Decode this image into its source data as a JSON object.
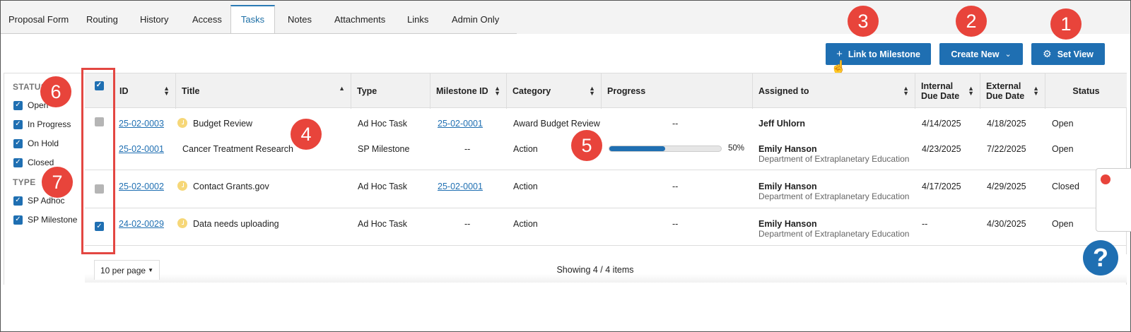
{
  "tabs": [
    {
      "label": "Proposal Form"
    },
    {
      "label": "Routing"
    },
    {
      "label": "History"
    },
    {
      "label": "Access"
    },
    {
      "label": "Tasks"
    },
    {
      "label": "Notes"
    },
    {
      "label": "Attachments"
    },
    {
      "label": "Links"
    },
    {
      "label": "Admin Only"
    }
  ],
  "active_tab": "Tasks",
  "toolbar": {
    "link_label": "Link to Milestone",
    "create_label": "Create New",
    "setview_label": "Set View"
  },
  "callouts": [
    "1",
    "2",
    "3",
    "4",
    "5",
    "6",
    "7"
  ],
  "filters": {
    "status_label": "STATUS",
    "status_items": [
      {
        "label": "Open",
        "checked": true
      },
      {
        "label": "In Progress",
        "checked": true
      },
      {
        "label": "On Hold",
        "checked": true
      },
      {
        "label": "Closed",
        "checked": true
      }
    ],
    "type_label": "TYPE",
    "type_items": [
      {
        "label": "SP Adhoc",
        "checked": true
      },
      {
        "label": "SP Milestone",
        "checked": true
      }
    ]
  },
  "table": {
    "columns": {
      "id": "ID",
      "title": "Title",
      "type": "Type",
      "milestone": "Milestone ID",
      "category": "Category",
      "progress": "Progress",
      "assigned": "Assigned to",
      "internal_1": "Internal",
      "internal_2": "Due Date",
      "external_1": "External",
      "external_2": "Due Date",
      "status": "Status"
    },
    "rows": [
      {
        "id": "25-02-0003",
        "title": "Budget Review",
        "type": "Ad Hoc Task",
        "milestone": "25-02-0001",
        "category": "Award Budget Review",
        "progress": "--",
        "assigned": "Jeff Uhlorn",
        "dept": "",
        "internal": "4/14/2025",
        "external": "4/18/2025",
        "status": "Open",
        "selected": false
      },
      {
        "id": "25-02-0001",
        "title": "Cancer Treatment Research",
        "type": "SP Milestone",
        "milestone": "--",
        "category": "Action",
        "progress_pct": 50,
        "progress_text": "50%",
        "assigned": "Emily Hanson",
        "dept": "Department of Extraplanetary Education",
        "internal": "4/23/2025",
        "external": "7/22/2025",
        "status": "Open"
      },
      {
        "id": "25-02-0002",
        "title": "Contact Grants.gov",
        "type": "Ad Hoc Task",
        "milestone": "25-02-0001",
        "category": "Action",
        "progress": "--",
        "assigned": "Emily Hanson",
        "dept": "Department of Extraplanetary Education",
        "internal": "4/17/2025",
        "external": "4/29/2025",
        "status": "Closed",
        "selected": false
      },
      {
        "id": "24-02-0029",
        "title": "Data needs uploading",
        "type": "Ad Hoc Task",
        "milestone": "--",
        "category": "Action",
        "progress": "--",
        "assigned": "Emily Hanson",
        "dept": "Department of Extraplanetary Education",
        "internal": "--",
        "external": "4/30/2025",
        "status": "Open",
        "selected": true
      }
    ]
  },
  "footer": {
    "per_page": "10 per page",
    "showing": "Showing 4 / 4 items"
  },
  "help_label": "?",
  "colors": {
    "accent": "#1f6fb2",
    "callout": "#e8443b",
    "highlight_box": "#e34742"
  }
}
